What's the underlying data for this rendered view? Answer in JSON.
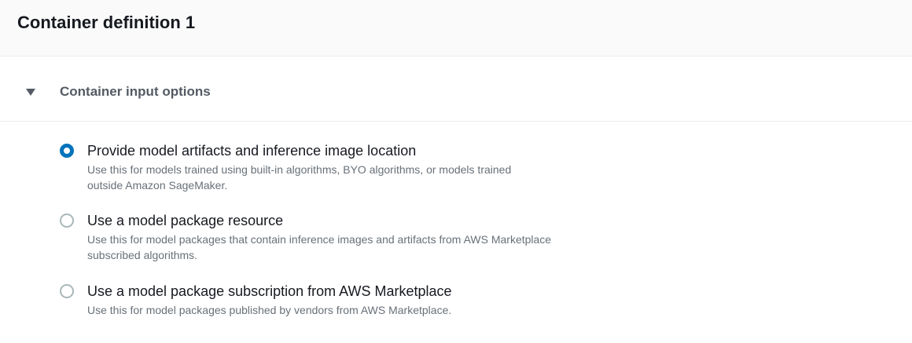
{
  "header": {
    "title": "Container definition 1"
  },
  "section": {
    "title": "Container input options",
    "expanded": true
  },
  "options": [
    {
      "label": "Provide model artifacts and inference image location",
      "description_line1": "Use this for models trained using built-in algorithms, BYO algorithms, or models trained",
      "description_line2": "outside Amazon SageMaker.",
      "selected": true
    },
    {
      "label": "Use a model package resource",
      "description_line1": "Use this for model packages that contain inference images and artifacts from AWS Marketplace",
      "description_line2": "subscribed algorithms.",
      "selected": false
    },
    {
      "label": "Use a model package subscription from AWS Marketplace",
      "description_line1": "Use this for model packages published by vendors from AWS Marketplace.",
      "description_line2": "",
      "selected": false
    }
  ],
  "colors": {
    "accent": "#0073bb",
    "text": "#16191f",
    "muted": "#687078",
    "header_bg": "#fafafa"
  }
}
